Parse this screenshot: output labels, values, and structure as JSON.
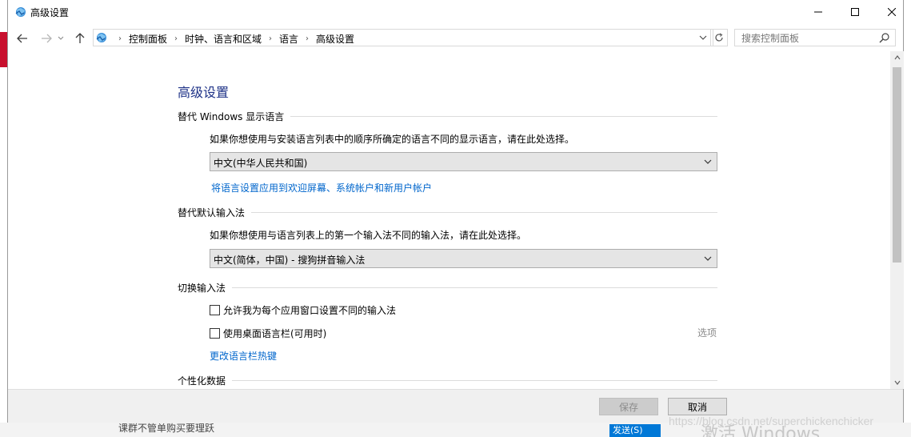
{
  "window": {
    "title": "高级设置"
  },
  "nav": {
    "breadcrumbs": [
      "控制面板",
      "时钟、语言和区域",
      "语言",
      "高级设置"
    ],
    "search_placeholder": "搜索控制面板"
  },
  "main": {
    "page_title": "高级设置",
    "display_language": {
      "heading": "替代 Windows 显示语言",
      "description": "如果你想使用与安装语言列表中的顺序所确定的语言不同的显示语言，请在此处选择。",
      "selected": "中文(中华人民共和国)",
      "apply_link": "将语言设置应用到欢迎屏幕、系统帐户和新用户帐户"
    },
    "input_method": {
      "heading": "替代默认输入法",
      "description": "如果你想使用与语言列表上的第一个输入法不同的输入法，请在此处选择。",
      "selected": "中文(简体，中国) - 搜狗拼音输入法"
    },
    "switch_input": {
      "heading": "切换输入法",
      "checkbox_per_app": "允许我为每个应用窗口设置不同的输入法",
      "checkbox_per_app_checked": false,
      "checkbox_language_bar": "使用桌面语言栏(可用时)",
      "checkbox_language_bar_checked": false,
      "options_link": "选项",
      "hotkeys_link": "更改语言栏热键"
    },
    "personalization": {
      "heading": "个性化数据"
    }
  },
  "footer": {
    "save_label": "保存",
    "cancel_label": "取消"
  },
  "background": {
    "bottom_text": "课群不管单购买要理跃",
    "bottom_button": "发送(S)",
    "activate_text": "激活 Windows",
    "watermark": "https://blog.csdn.net/superchickenchicker"
  },
  "colors": {
    "title_blue": "#1e3287",
    "link_blue": "#0066cc",
    "accent_red": "#c8102e"
  }
}
